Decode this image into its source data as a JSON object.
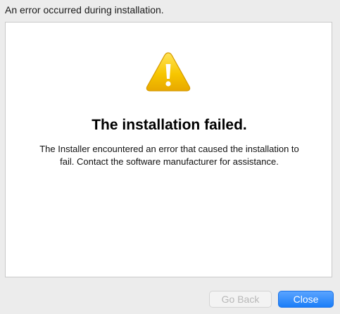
{
  "header": {
    "text": "An error occurred during installation."
  },
  "content": {
    "icon": "warning-triangle-icon",
    "title": "The installation failed.",
    "message": "The Installer encountered an error that caused the installation to fail. Contact the software manufacturer for assistance."
  },
  "buttons": {
    "go_back": {
      "label": "Go Back",
      "enabled": false
    },
    "close": {
      "label": "Close",
      "enabled": true
    }
  },
  "colors": {
    "window_background": "#ececec",
    "panel_background": "#ffffff",
    "accent_button": "#1b7ef8",
    "warning_yellow": "#f5c000",
    "disabled_text": "#b8b8b8"
  }
}
